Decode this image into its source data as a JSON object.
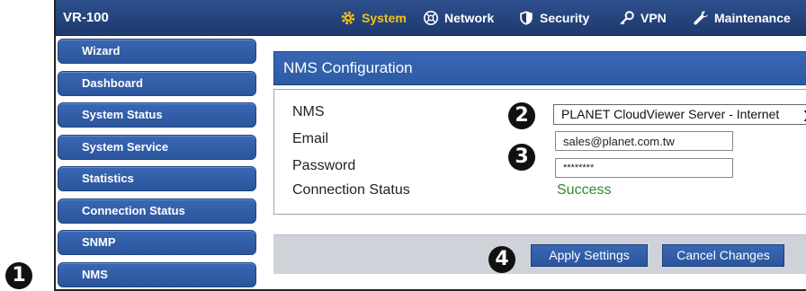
{
  "header": {
    "brand": "VR-100",
    "nav": [
      {
        "label": "System",
        "icon": "gear-icon",
        "active": true
      },
      {
        "label": "Network",
        "icon": "network-icon",
        "active": false
      },
      {
        "label": "Security",
        "icon": "shield-icon",
        "active": false
      },
      {
        "label": "VPN",
        "icon": "key-icon",
        "active": false
      },
      {
        "label": "Maintenance",
        "icon": "wrench-icon",
        "active": false
      }
    ]
  },
  "sidebar": {
    "items": [
      {
        "label": "Wizard"
      },
      {
        "label": "Dashboard"
      },
      {
        "label": "System Status"
      },
      {
        "label": "System Service"
      },
      {
        "label": "Statistics"
      },
      {
        "label": "Connection Status"
      },
      {
        "label": "SNMP"
      },
      {
        "label": "NMS"
      }
    ]
  },
  "panel": {
    "title": "NMS Configuration",
    "fields": {
      "nms_label": "NMS",
      "nms_value": "PLANET CloudViewer Server - Internet",
      "email_label": "Email",
      "email_value": "sales@planet.com.tw",
      "password_label": "Password",
      "password_value": "********",
      "status_label": "Connection Status",
      "status_value": "Success"
    }
  },
  "buttons": {
    "apply": "Apply Settings",
    "cancel": "Cancel Changes"
  },
  "callouts": [
    "1",
    "2",
    "3",
    "4"
  ],
  "colors": {
    "accent": "#2a559c",
    "active_nav": "#f4c21a",
    "success": "#2f8a2f"
  }
}
